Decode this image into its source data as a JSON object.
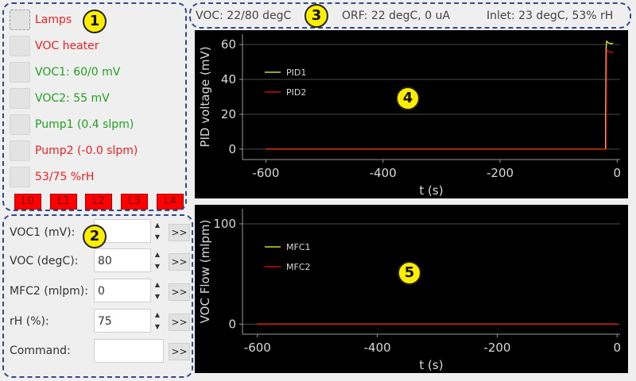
{
  "colors": {
    "red": "#ee2222",
    "green": "#22a022",
    "annotation_border": "#2e4a8c",
    "badge": "#ffee00"
  },
  "annotations": [
    "1",
    "2",
    "3",
    "4",
    "5"
  ],
  "toggles": [
    {
      "label": "Lamps",
      "color": "red"
    },
    {
      "label": "VOC heater",
      "color": "red"
    },
    {
      "label": "VOC1: 60/0 mV",
      "color": "green"
    },
    {
      "label": "VOC2: 55 mV",
      "color": "green"
    },
    {
      "label": "Pump1 (0.4 slpm)",
      "color": "green"
    },
    {
      "label": "Pump2 (-0.0 slpm)",
      "color": "red"
    },
    {
      "label": "53/75 %rH",
      "color": "red"
    }
  ],
  "level_buttons": [
    "L0",
    "L1",
    "L2",
    "L3",
    "L4"
  ],
  "form": {
    "rows": [
      {
        "label": "VOC1 (mV):",
        "value": "",
        "spinner": true,
        "go": ">>"
      },
      {
        "label": "VOC (degC):",
        "value": "80",
        "spinner": true,
        "go": ">>"
      },
      {
        "label": "MFC2 (mlpm):",
        "value": "0",
        "spinner": true,
        "go": ">>"
      },
      {
        "label": "rH (%):",
        "value": "75",
        "spinner": true,
        "go": ">>"
      },
      {
        "label": "Command:",
        "value": "",
        "spinner": false,
        "go": ">>"
      }
    ],
    "spin_up": "▲",
    "spin_down": "▼"
  },
  "status": {
    "voc": "VOC: 22/80 degC",
    "orf": "ORF: 22 degC, 0 uA",
    "inlet": "Inlet: 23 degC, 53% rH"
  },
  "chart_data": [
    {
      "type": "line",
      "xlabel": "t (s)",
      "ylabel": "PID voltage (mV)",
      "xlim": [
        -640,
        5
      ],
      "ylim": [
        -6,
        66
      ],
      "xticks": [
        -600,
        -400,
        -200,
        0
      ],
      "yticks": [
        0,
        20,
        40,
        60
      ],
      "grid": true,
      "legend": "upper-left",
      "series": [
        {
          "name": "PID1",
          "color": "#ffff33",
          "points": [
            [
              -600,
              0
            ],
            [
              -20,
              0
            ],
            [
              -19,
              58
            ],
            [
              -18,
              62
            ],
            [
              -15,
              61
            ],
            [
              -10,
              60.5
            ],
            [
              -7,
              61
            ]
          ]
        },
        {
          "name": "PID2",
          "color": "#ee1111",
          "points": [
            [
              -600,
              0
            ],
            [
              -19,
              0
            ],
            [
              -18,
              57
            ],
            [
              -15,
              56
            ],
            [
              -10,
              55.5
            ],
            [
              -7,
              55.5
            ]
          ]
        }
      ]
    },
    {
      "type": "line",
      "xlabel": "t (s)",
      "ylabel": "VOC Flow (mlpm)",
      "xlim": [
        -625,
        5
      ],
      "ylim": [
        -10,
        115
      ],
      "xticks": [
        -600,
        -400,
        -200,
        0
      ],
      "yticks": [
        0,
        100
      ],
      "grid": true,
      "legend": "upper-left",
      "series": [
        {
          "name": "MFC1",
          "color": "#ffff33",
          "points": [
            [
              -600,
              0
            ],
            [
              0,
              0
            ]
          ]
        },
        {
          "name": "MFC2",
          "color": "#ee1111",
          "points": [
            [
              -600,
              0
            ],
            [
              0,
              0
            ]
          ]
        }
      ]
    }
  ]
}
